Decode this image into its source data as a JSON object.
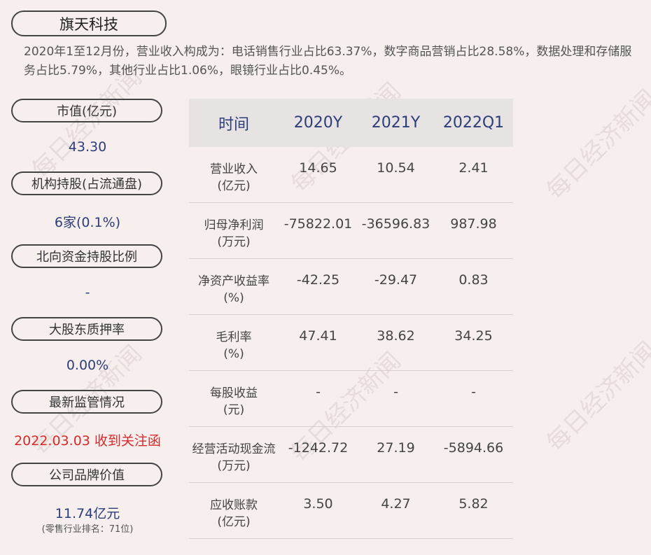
{
  "company_name": "旗天科技",
  "summary": "2020年1至12月份，营业收入构成为：电话销售行业占比63.37%，数字商品营销占比28.58%，数据处理和存储服务占比5.79%，其他行业占比1.06%，眼镜行业占比0.45%。",
  "watermark": "每日经济新闻",
  "metrics": [
    {
      "label": "市值(亿元)",
      "value": "43.30"
    },
    {
      "label": "机构持股(占流通盘)",
      "value": "6家(0.1%)"
    },
    {
      "label": "北向资金持股比例",
      "value": "-"
    },
    {
      "label": "大股东质押率",
      "value": "0.00%"
    },
    {
      "label": "最新监管情况",
      "value": "2022.03.03 收到关注函"
    },
    {
      "label": "公司品牌价值",
      "value": "11.74亿元",
      "sub": "(零售行业排名：71位)"
    }
  ],
  "table": {
    "headers": [
      "时间",
      "2020Y",
      "2021Y",
      "2022Q1"
    ],
    "rows": [
      {
        "label": "营业收入",
        "unit": "(亿元)",
        "values": [
          "14.65",
          "10.54",
          "2.41"
        ]
      },
      {
        "label": "归母净利润",
        "unit": "(万元)",
        "values": [
          "-75822.01",
          "-36596.83",
          "987.98"
        ]
      },
      {
        "label": "净资产收益率",
        "unit": "(%)",
        "values": [
          "-42.25",
          "-29.47",
          "0.83"
        ]
      },
      {
        "label": "毛利率",
        "unit": "(%)",
        "values": [
          "47.41",
          "38.62",
          "34.25"
        ]
      },
      {
        "label": "每股收益",
        "unit": "(元)",
        "values": [
          "-",
          "-",
          "-"
        ]
      },
      {
        "label": "经营活动现金流",
        "unit": "(万元)",
        "values": [
          "-1242.72",
          "27.19",
          "-5894.66"
        ]
      },
      {
        "label": "应收账款",
        "unit": "(亿元)",
        "values": [
          "3.50",
          "4.27",
          "5.82"
        ]
      }
    ]
  }
}
